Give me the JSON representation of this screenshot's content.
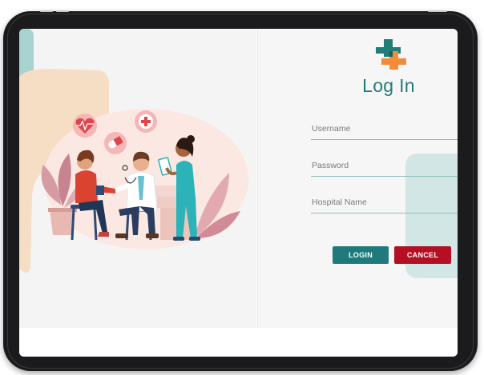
{
  "login": {
    "title": "Log In",
    "username_placeholder": "Username",
    "password_placeholder": "Password",
    "hospital_placeholder": "Hospital Name",
    "login_label": "LOGIN",
    "cancel_label": "CANCEL"
  },
  "colors": {
    "accent_teal": "#1f7b7b",
    "title_teal": "#237c7a",
    "cancel_red": "#b50f24",
    "logo_teal": "#227d78",
    "logo_orange": "#f28b3a"
  },
  "icons": [
    "medical-cross-logo-icon",
    "heart-pulse-icon",
    "pill-icon",
    "first-aid-cross-icon"
  ]
}
